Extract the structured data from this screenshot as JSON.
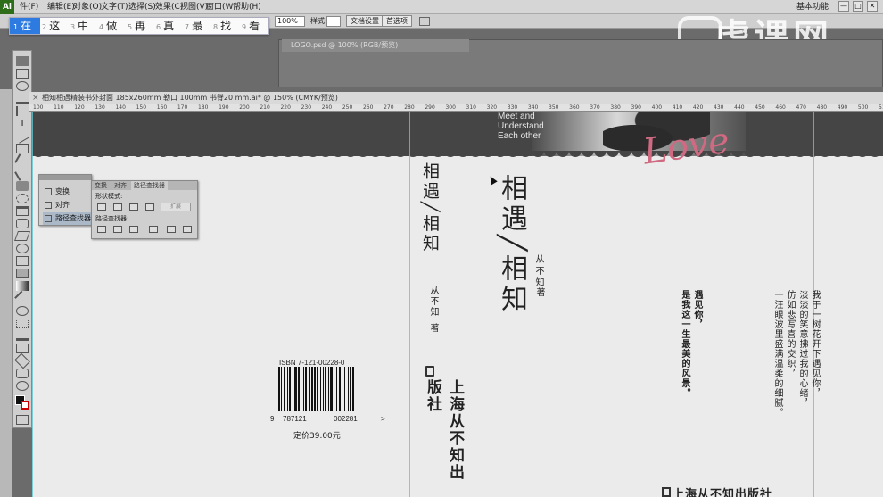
{
  "menubar": {
    "app_icon": "Ai",
    "items": [
      "件(F)",
      "编辑(E)",
      "对象(O)",
      "文字(T)",
      "选择(S)",
      "效果(C)",
      "视图(V)",
      "窗口(W)",
      "帮助(H)"
    ],
    "workspace": "基本功能",
    "window_buttons": [
      "—",
      "□",
      "✕"
    ]
  },
  "control_bar": {
    "zoom": "100%",
    "style_label": "样式:",
    "doc_setup": "文档设置",
    "preferences": "首选项"
  },
  "ime": {
    "candidates": [
      {
        "n": "1",
        "c": "在",
        "selected": true
      },
      {
        "n": "2",
        "c": "这"
      },
      {
        "n": "3",
        "c": "中"
      },
      {
        "n": "4",
        "c": "做"
      },
      {
        "n": "5",
        "c": "再"
      },
      {
        "n": "6",
        "c": "真"
      },
      {
        "n": "7",
        "c": "最"
      },
      {
        "n": "8",
        "c": "找"
      },
      {
        "n": "9",
        "c": "看"
      }
    ]
  },
  "watermark": "虎课网",
  "logo_window": {
    "tab": "LOGO.psd @ 100% (RGB/预览)"
  },
  "document": {
    "title": "相知相遇精装书外封面 185x260mm 勒口 100mm 书脊20 mm.ai* @ 150% (CMYK/预览)",
    "ruler_ticks": [
      "100",
      "110",
      "120",
      "130",
      "140",
      "150",
      "160",
      "170",
      "180",
      "190",
      "200",
      "210",
      "220",
      "230",
      "240",
      "250",
      "260",
      "270",
      "280",
      "290",
      "300",
      "310",
      "320",
      "330",
      "340",
      "350",
      "360",
      "370",
      "380",
      "390",
      "400",
      "410",
      "420",
      "430",
      "440",
      "450",
      "460",
      "470",
      "480",
      "490",
      "500",
      "510"
    ]
  },
  "cover": {
    "meet": [
      "Meet and",
      "Understand",
      "Each other"
    ],
    "love": "Love",
    "spine_title": "相遇╱相知",
    "spine_author": "从不知",
    "spine_zhu": "著",
    "spine_publisher": "上海从不知出版社",
    "front_title": "相遇╱相知",
    "front_author": "从不知",
    "front_zhu": "著",
    "poem_a": [
      "我于一树花开下遇见你，",
      "淡淡的笑意拂过我的心绪，",
      "仿如悲写喜的交织，",
      "一汪眼波里盛满温柔的细腻。"
    ],
    "poem_b": [
      "遇见你，",
      "是我这一生最美的风景。"
    ],
    "bottom_publisher": "上海从不知出版社",
    "isbn": "ISBN 7-121-00228-0",
    "barcode_digits": [
      "9",
      "787121",
      "002281",
      ">"
    ],
    "price": "定价39.00元"
  },
  "panel_small": {
    "items": [
      "变换",
      "对齐",
      "路径查找器"
    ]
  },
  "panel_pathfinder": {
    "tabs": [
      "变换",
      "对齐",
      "路径查找器"
    ],
    "shape_modes": "形状模式:",
    "pathfinders": "路径查找器:",
    "expand": "扩展"
  }
}
